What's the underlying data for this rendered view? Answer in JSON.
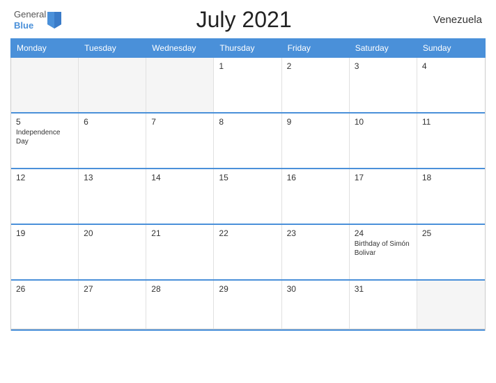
{
  "header": {
    "title": "July 2021",
    "country": "Venezuela",
    "logo_general": "General",
    "logo_blue": "Blue"
  },
  "dayHeaders": [
    "Monday",
    "Tuesday",
    "Wednesday",
    "Thursday",
    "Friday",
    "Saturday",
    "Sunday"
  ],
  "weeks": [
    [
      {
        "day": "",
        "empty": true
      },
      {
        "day": "",
        "empty": true
      },
      {
        "day": "",
        "empty": true
      },
      {
        "day": "1",
        "event": ""
      },
      {
        "day": "2",
        "event": ""
      },
      {
        "day": "3",
        "event": ""
      },
      {
        "day": "4",
        "event": ""
      }
    ],
    [
      {
        "day": "5",
        "event": "Independence Day"
      },
      {
        "day": "6",
        "event": ""
      },
      {
        "day": "7",
        "event": ""
      },
      {
        "day": "8",
        "event": ""
      },
      {
        "day": "9",
        "event": ""
      },
      {
        "day": "10",
        "event": ""
      },
      {
        "day": "11",
        "event": ""
      }
    ],
    [
      {
        "day": "12",
        "event": ""
      },
      {
        "day": "13",
        "event": ""
      },
      {
        "day": "14",
        "event": ""
      },
      {
        "day": "15",
        "event": ""
      },
      {
        "day": "16",
        "event": ""
      },
      {
        "day": "17",
        "event": ""
      },
      {
        "day": "18",
        "event": ""
      }
    ],
    [
      {
        "day": "19",
        "event": ""
      },
      {
        "day": "20",
        "event": ""
      },
      {
        "day": "21",
        "event": ""
      },
      {
        "day": "22",
        "event": ""
      },
      {
        "day": "23",
        "event": ""
      },
      {
        "day": "24",
        "event": "Birthday of Simón Bolivar"
      },
      {
        "day": "25",
        "event": ""
      }
    ],
    [
      {
        "day": "26",
        "event": ""
      },
      {
        "day": "27",
        "event": ""
      },
      {
        "day": "28",
        "event": ""
      },
      {
        "day": "29",
        "event": ""
      },
      {
        "day": "30",
        "event": ""
      },
      {
        "day": "31",
        "event": ""
      },
      {
        "day": "",
        "empty": true
      }
    ]
  ]
}
